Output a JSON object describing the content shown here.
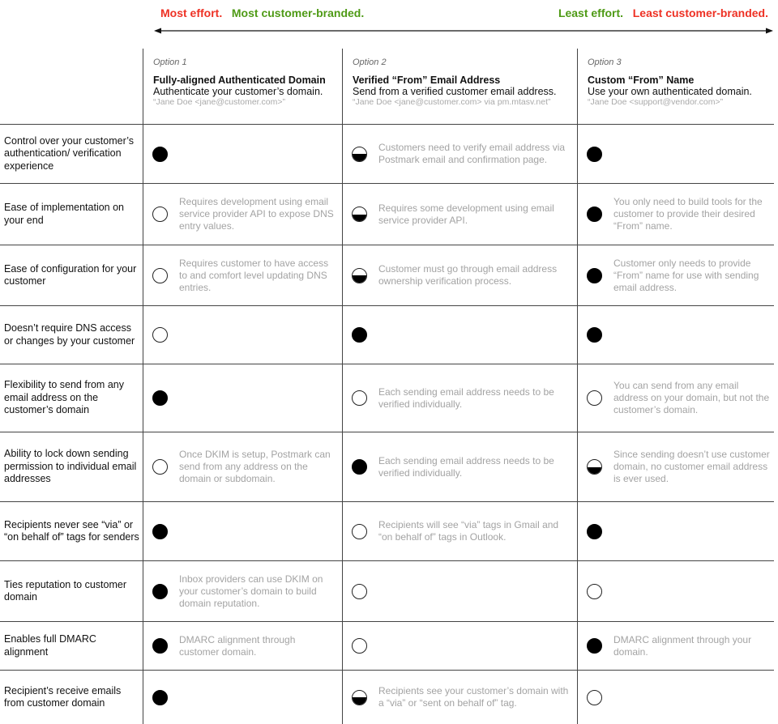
{
  "scale": {
    "left": {
      "effort": "Most effort.",
      "branding": "Most customer-branded."
    },
    "right": {
      "effort": "Least effort.",
      "branding": "Least customer-branded."
    },
    "colors": {
      "red": "#ee3124",
      "green": "#4e9a15"
    }
  },
  "options": [
    {
      "number": "Option 1",
      "title": "Fully-aligned Authenticated Domain",
      "subtitle": "Authenticate your customer’s domain.",
      "example": "“Jane Doe <jane@customer.com>”"
    },
    {
      "number": "Option 2",
      "title": "Verified “From” Email Address",
      "subtitle": "Send from a verified customer email address.",
      "example": "“Jane Doe <jane@customer.com> via pm.mtasv.net”"
    },
    {
      "number": "Option 3",
      "title": "Custom “From” Name",
      "subtitle": "Use your own authenticated domain.",
      "example": "“Jane Doe <support@vendor.com>”"
    }
  ],
  "legend_icons": {
    "full": "filled-circle-icon",
    "half": "half-filled-circle-icon",
    "empty": "empty-circle-icon"
  },
  "rows": [
    {
      "label": "Control over your customer’s authentication/ verification experience",
      "cells": [
        {
          "rating": "full",
          "note": ""
        },
        {
          "rating": "half",
          "note": "Customers need to verify email address via Postmark email and confirmation page."
        },
        {
          "rating": "full",
          "note": ""
        }
      ]
    },
    {
      "label": "Ease of implementation on your end",
      "cells": [
        {
          "rating": "empty",
          "note": "Requires development using email service provider API to expose DNS entry values."
        },
        {
          "rating": "half",
          "note": "Requires some development using email service provider API."
        },
        {
          "rating": "full",
          "note": "You only need to build tools for the customer to provide their desired “From” name."
        }
      ]
    },
    {
      "label": "Ease of configuration for your customer",
      "cells": [
        {
          "rating": "empty",
          "note": "Requires customer to have access to and comfort level updating DNS entries."
        },
        {
          "rating": "half",
          "note": "Customer must go through email address ownership verification process."
        },
        {
          "rating": "full",
          "note": "Customer only needs to provide “From” name for use with sending email address."
        }
      ]
    },
    {
      "label": "Doesn’t require DNS access or changes by your customer",
      "cells": [
        {
          "rating": "empty",
          "note": ""
        },
        {
          "rating": "full",
          "note": ""
        },
        {
          "rating": "full",
          "note": ""
        }
      ]
    },
    {
      "label": "Flexibility to send from any email address on the customer’s domain",
      "cells": [
        {
          "rating": "full",
          "note": ""
        },
        {
          "rating": "empty",
          "note": "Each sending email address needs to be verified individually."
        },
        {
          "rating": "empty",
          "note": "You can send from any email address on your domain, but not the customer’s domain."
        }
      ]
    },
    {
      "label": "Ability to lock down sending permission to individual email addresses",
      "cells": [
        {
          "rating": "empty",
          "note": "Once DKIM is setup, Postmark can send from any address on the domain or subdomain."
        },
        {
          "rating": "full",
          "note": "Each sending email address needs to be verified individually."
        },
        {
          "rating": "half",
          "note": "Since sending doesn’t use customer domain, no customer email address is ever used."
        }
      ]
    },
    {
      "label": "Recipients never see “via” or “on behalf of” tags for senders",
      "cells": [
        {
          "rating": "full",
          "note": ""
        },
        {
          "rating": "empty",
          "note": "Recipients will see “via” tags in Gmail and “on behalf of” tags in Outlook."
        },
        {
          "rating": "full",
          "note": ""
        }
      ]
    },
    {
      "label": "Ties reputation to customer domain",
      "cells": [
        {
          "rating": "full",
          "note": "Inbox providers can use DKIM on your customer’s domain to build domain reputation."
        },
        {
          "rating": "empty",
          "note": ""
        },
        {
          "rating": "empty",
          "note": ""
        }
      ]
    },
    {
      "label": "Enables full DMARC alignment",
      "cells": [
        {
          "rating": "full",
          "note": "DMARC alignment through customer domain."
        },
        {
          "rating": "empty",
          "note": ""
        },
        {
          "rating": "full",
          "note": "DMARC alignment through your domain."
        }
      ]
    },
    {
      "label": "Recipient’s receive emails from customer domain",
      "cells": [
        {
          "rating": "full",
          "note": ""
        },
        {
          "rating": "half",
          "note": "Recipients see your customer’s domain with a “via” or “sent on behalf of” tag."
        },
        {
          "rating": "empty",
          "note": ""
        }
      ]
    }
  ]
}
